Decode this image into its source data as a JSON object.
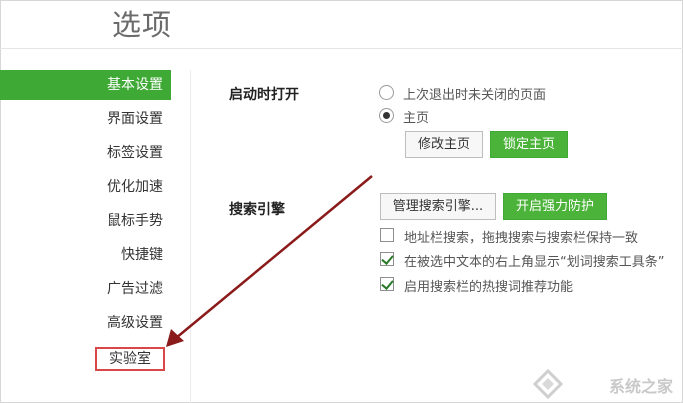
{
  "page": {
    "title": "选项"
  },
  "sidebar": {
    "items": [
      {
        "label": "基本设置",
        "active": true
      },
      {
        "label": "界面设置"
      },
      {
        "label": "标签设置"
      },
      {
        "label": "优化加速"
      },
      {
        "label": "鼠标手势"
      },
      {
        "label": "快捷键"
      },
      {
        "label": "广告过滤"
      },
      {
        "label": "高级设置"
      },
      {
        "label": "实验室",
        "highlighted": true
      }
    ]
  },
  "startup": {
    "label": "启动时打开",
    "options": [
      {
        "text": "上次退出时未关闭的页面",
        "checked": false
      },
      {
        "text": "主页",
        "checked": true
      }
    ],
    "modify_home": "修改主页",
    "lock_home": "锁定主页"
  },
  "search": {
    "label": "搜索引擎",
    "manage": "管理搜索引擎...",
    "protect": "开启强力防护",
    "checks": [
      {
        "text": "地址栏搜索，拖拽搜索与搜索栏保持一致",
        "checked": false
      },
      {
        "text": "在被选中文本的右上角显示“划词搜索工具条”",
        "checked": true
      },
      {
        "text": "启用搜索栏的热搜词推荐功能",
        "checked": true
      }
    ]
  },
  "watermark": {
    "text": "系统之家"
  },
  "colors": {
    "accent": "#3ea934",
    "highlight_box": "#d94849",
    "arrow": "#8b1a1a"
  }
}
